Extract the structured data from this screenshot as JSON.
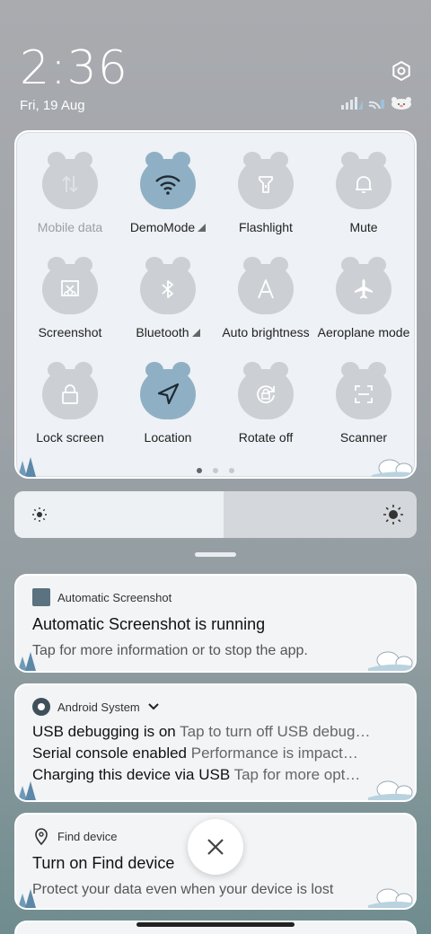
{
  "status": {
    "time": "2:36",
    "date": "Fri, 19 Aug"
  },
  "quick_settings": {
    "tiles": [
      {
        "label": "Mobile data",
        "icon": "mobile-data-icon",
        "state": "disabled"
      },
      {
        "label": "DemoMode",
        "icon": "wifi-icon",
        "state": "active",
        "has_menu": true
      },
      {
        "label": "Flashlight",
        "icon": "flashlight-icon",
        "state": "off"
      },
      {
        "label": "Mute",
        "icon": "bell-icon",
        "state": "off"
      },
      {
        "label": "Screenshot",
        "icon": "screenshot-icon",
        "state": "off"
      },
      {
        "label": "Bluetooth",
        "icon": "bluetooth-icon",
        "state": "off",
        "has_menu": true
      },
      {
        "label": "Auto brightness",
        "icon": "auto-brightness-icon",
        "state": "off"
      },
      {
        "label": "Aeroplane mode",
        "icon": "airplane-icon",
        "state": "off"
      },
      {
        "label": "Lock screen",
        "icon": "lock-icon",
        "state": "off"
      },
      {
        "label": "Location",
        "icon": "location-icon",
        "state": "active"
      },
      {
        "label": "Rotate off",
        "icon": "rotate-icon",
        "state": "off"
      },
      {
        "label": "Scanner",
        "icon": "scanner-icon",
        "state": "off"
      }
    ],
    "page_count": 3,
    "current_page": 1
  },
  "brightness": {
    "level": 0.52
  },
  "notifications": [
    {
      "app": "Automatic Screenshot",
      "title": "Automatic Screenshot is running",
      "body": "Tap for more information or to stop the app."
    },
    {
      "app": "Android System",
      "lines": [
        {
          "title": "USB debugging is on",
          "text": "Tap to turn off USB debug…"
        },
        {
          "title": "Serial console enabled",
          "text": "Performance is impact…"
        },
        {
          "title": "Charging this device via USB",
          "text": "Tap for more opt…"
        }
      ]
    },
    {
      "app": "Find device",
      "title": "Turn on Find device",
      "body": "Protect your data even when your device is lost"
    }
  ],
  "colors": {
    "active_tile": "#8fb0c4",
    "inactive_tile": "#ccd0d4",
    "card_bg": "#f2f4f6"
  }
}
